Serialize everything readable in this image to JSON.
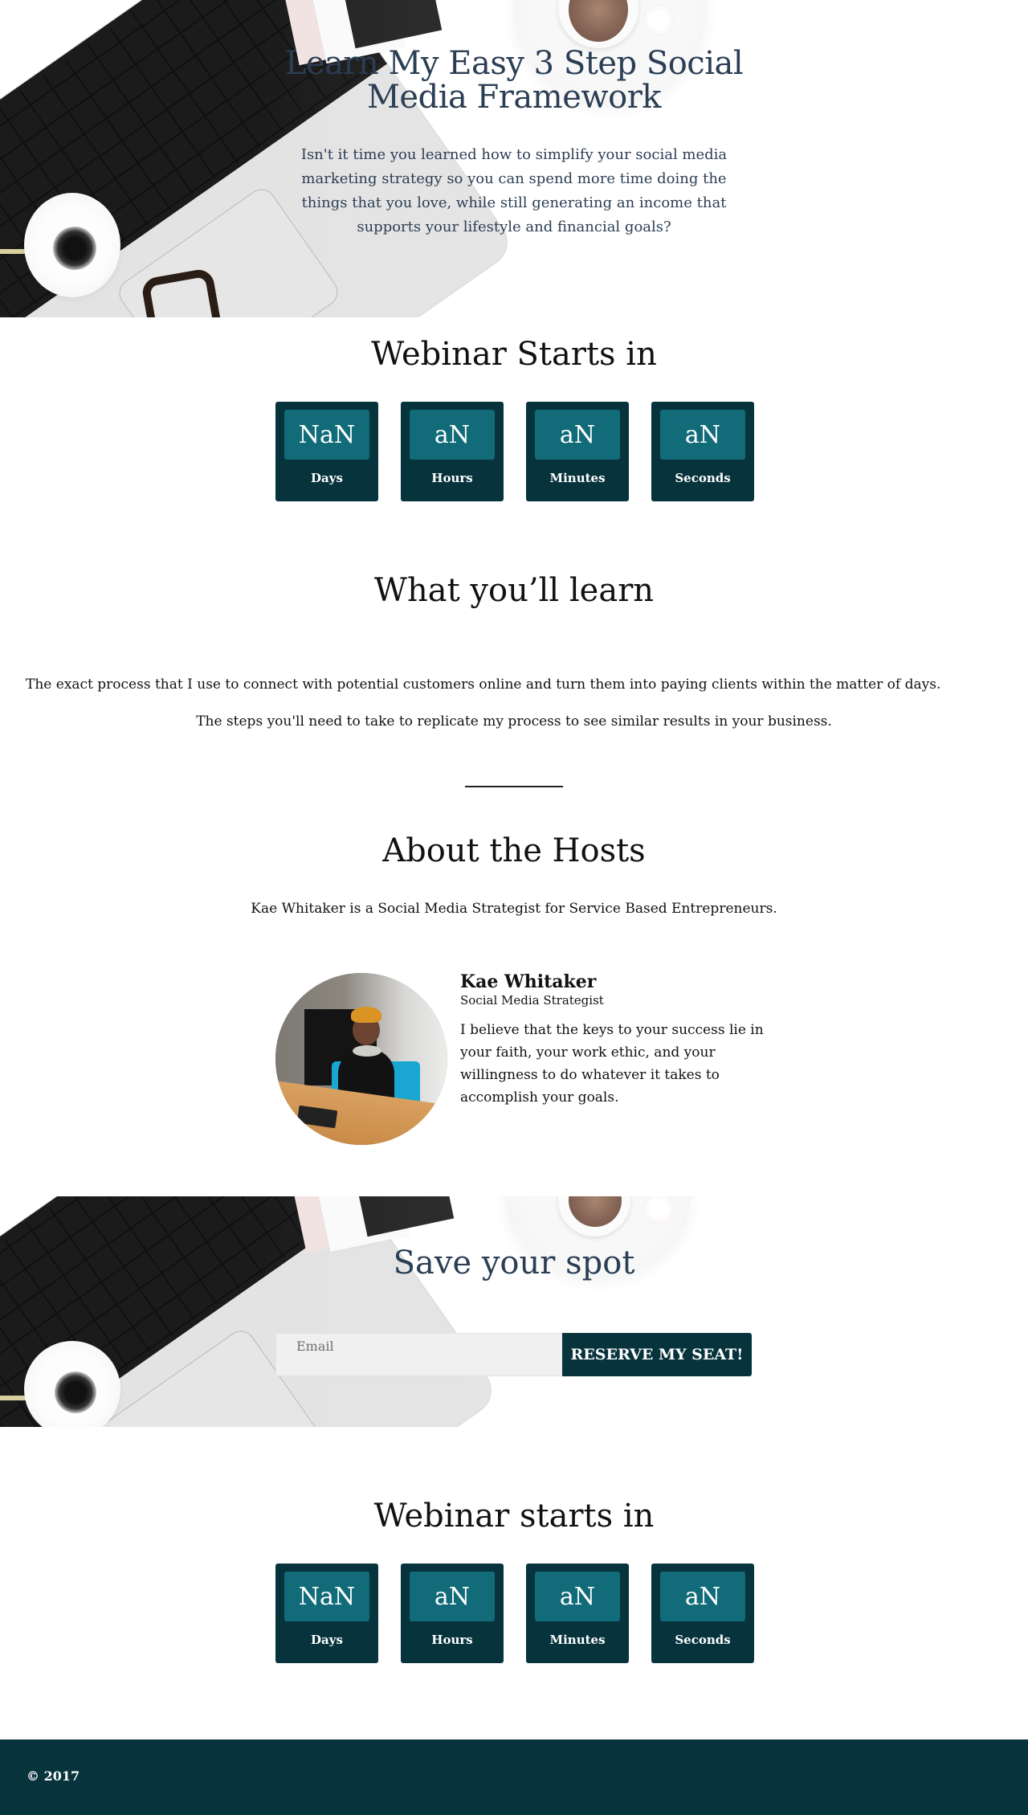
{
  "hero": {
    "title": "Learn My Easy 3 Step Social Media Framework",
    "description": "Isn't it time you learned how to simplify your social media marketing strategy so you can spend more time doing the things that you love, while still generating an income that supports your lifestyle and financial goals?"
  },
  "countdown_top": {
    "title": "Webinar Starts in",
    "units": [
      {
        "value": "NaN",
        "label": "Days"
      },
      {
        "value": "aN",
        "label": "Hours"
      },
      {
        "value": "aN",
        "label": "Minutes"
      },
      {
        "value": "aN",
        "label": "Seconds"
      }
    ]
  },
  "learn": {
    "title": "What you’ll learn",
    "items": [
      "The exact process that I use to connect with potential customers online and turn them into paying clients within the matter of days.",
      "The steps you'll need to take to replicate my process to see similar results in your business."
    ]
  },
  "about": {
    "title": "About the Hosts",
    "intro": "Kae Whitaker is a Social Media Strategist for Service Based Entrepreneurs.",
    "host": {
      "name": "Kae Whitaker",
      "role": "Social Media Strategist",
      "quote": "I believe that the keys to your success lie in your faith, your work ethic, and your willingness to do whatever it takes to accomplish your goals.",
      "photo_alt": "Kae Whitaker seated at a wooden desk"
    }
  },
  "signup": {
    "title": "Save your spot",
    "email_placeholder": "Email",
    "email_value": "",
    "button_label": "RESERVE MY SEAT!"
  },
  "countdown_bottom": {
    "title": "Webinar starts in",
    "units": [
      {
        "value": "NaN",
        "label": "Days"
      },
      {
        "value": "aN",
        "label": "Hours"
      },
      {
        "value": "aN",
        "label": "Minutes"
      },
      {
        "value": "aN",
        "label": "Seconds"
      }
    ]
  },
  "footer": {
    "copyright": "© 2017"
  },
  "colors": {
    "heading_navy": "#2b3e54",
    "dark_teal": "#07333d",
    "teal": "#116b79",
    "input_gray": "#f0f0f0"
  }
}
